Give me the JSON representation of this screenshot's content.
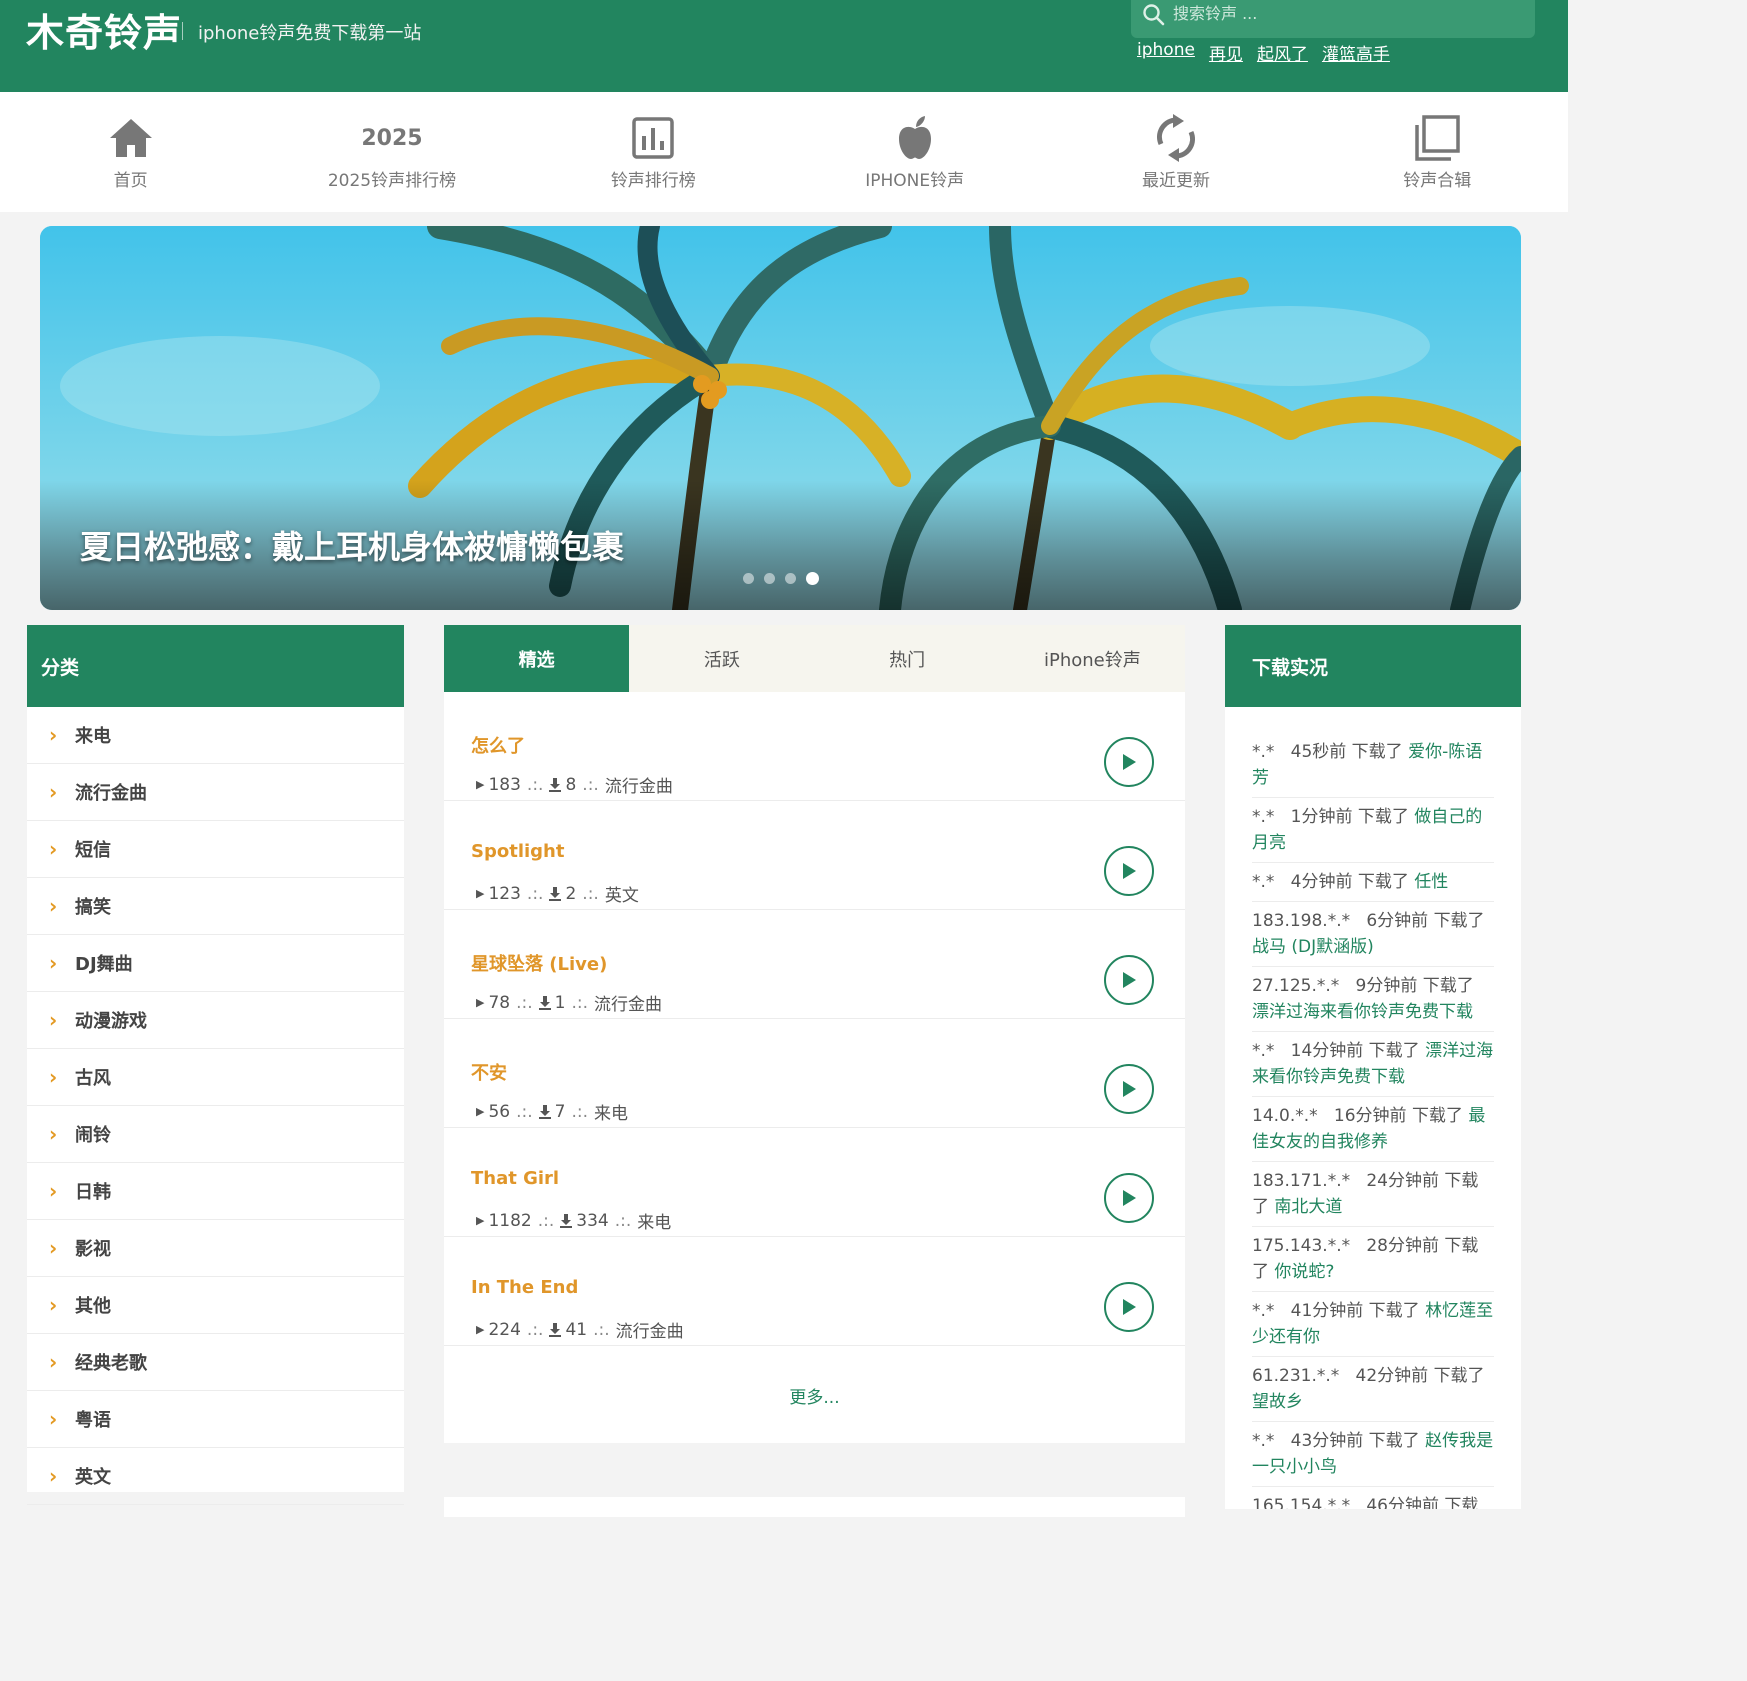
{
  "header": {
    "logo": "木奇铃声",
    "tagline": "iphone铃声免费下载第一站",
    "search_placeholder": "搜索铃声 ...",
    "hot_links": [
      "iphone",
      "再见",
      "起风了",
      "灌篮高手"
    ]
  },
  "nav": {
    "items": [
      {
        "label": "首页",
        "icon": "home-icon"
      },
      {
        "label": "2025铃声排行榜",
        "icon_text": "2025"
      },
      {
        "label": "铃声排行榜",
        "icon": "chart-icon"
      },
      {
        "label": "IPHONE铃声",
        "icon": "apple-icon"
      },
      {
        "label": "最近更新",
        "icon": "refresh-icon"
      },
      {
        "label": "铃声合辑",
        "icon": "collection-icon"
      }
    ]
  },
  "banner": {
    "title": "夏日松弛感：戴上耳机身体被慵懒包裹",
    "slide_count": 4,
    "active_slide": 4
  },
  "sidebar": {
    "title": "分类",
    "categories": [
      "来电",
      "流行金曲",
      "短信",
      "搞笑",
      "DJ舞曲",
      "动漫游戏",
      "古风",
      "闹铃",
      "日韩",
      "影视",
      "其他",
      "经典老歌",
      "粤语",
      "英文"
    ]
  },
  "main": {
    "tabs": [
      "精选",
      "活跃",
      "热门",
      "iPhone铃声"
    ],
    "active_tab": 0,
    "sep": ".:.",
    "songs": [
      {
        "title": "怎么了",
        "plays": "183",
        "downloads": "8",
        "category": "流行金曲"
      },
      {
        "title": "Spotlight",
        "plays": "123",
        "downloads": "2",
        "category": "英文"
      },
      {
        "title": "星球坠落 (Live)",
        "plays": "78",
        "downloads": "1",
        "category": "流行金曲"
      },
      {
        "title": "不安",
        "plays": "56",
        "downloads": "7",
        "category": "来电"
      },
      {
        "title": "That Girl",
        "plays": "1182",
        "downloads": "334",
        "category": "来电"
      },
      {
        "title": "In The End",
        "plays": "224",
        "downloads": "41",
        "category": "流行金曲"
      }
    ],
    "more_label": "更多..."
  },
  "downloads": {
    "title": "下载实况",
    "items": [
      {
        "who": "*.*",
        "when": "45秒前",
        "verb": "下载了",
        "song": "爱你-陈语芳"
      },
      {
        "who": "*.*",
        "when": "1分钟前",
        "verb": "下载了",
        "song": "做自己的月亮"
      },
      {
        "who": "*.*",
        "when": "4分钟前",
        "verb": "下载了",
        "song": "任性"
      },
      {
        "who": "183.198.*.*",
        "when": "6分钟前",
        "verb": "下载了",
        "song": "战马 (DJ默涵版)"
      },
      {
        "who": "27.125.*.*",
        "when": "9分钟前",
        "verb": "下载了",
        "song": "漂洋过海来看你铃声免费下载"
      },
      {
        "who": "*.*",
        "when": "14分钟前",
        "verb": "下载了",
        "song": "漂洋过海来看你铃声免费下载"
      },
      {
        "who": "14.0.*.*",
        "when": "16分钟前",
        "verb": "下载了",
        "song": "最佳女友的自我修养"
      },
      {
        "who": "183.171.*.*",
        "when": "24分钟前",
        "verb": "下载了",
        "song": "南北大道"
      },
      {
        "who": "175.143.*.*",
        "when": "28分钟前",
        "verb": "下载了",
        "song": "你说蛇?"
      },
      {
        "who": "*.*",
        "when": "41分钟前",
        "verb": "下载了",
        "song": "林忆莲至少还有你"
      },
      {
        "who": "61.231.*.*",
        "when": "42分钟前",
        "verb": "下载了",
        "song": "望故乡"
      },
      {
        "who": "*.*",
        "when": "43分钟前",
        "verb": "下载了",
        "song": "赵传我是一只小小鸟"
      },
      {
        "who": "165.154.*.*",
        "when": "46分钟前",
        "verb": "下载了",
        "song": ""
      }
    ]
  },
  "colors": {
    "brand_green": "#22855f",
    "accent_orange": "#e0962a",
    "nav_gray": "#777777"
  }
}
